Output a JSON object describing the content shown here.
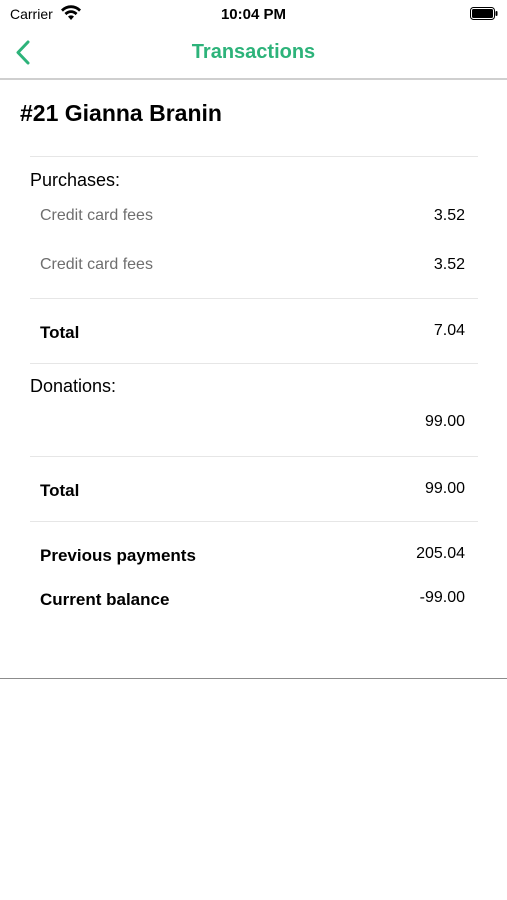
{
  "status_bar": {
    "carrier": "Carrier",
    "time": "10:04 PM"
  },
  "nav": {
    "title": "Transactions"
  },
  "customer": {
    "heading": "#21 Gianna Branin"
  },
  "purchases": {
    "label": "Purchases:",
    "items": [
      {
        "name": "Credit card fees",
        "amount": "3.52"
      },
      {
        "name": "Credit card fees",
        "amount": "3.52"
      }
    ],
    "total_label": "Total",
    "total_amount": "7.04"
  },
  "donations": {
    "label": "Donations:",
    "items": [
      {
        "name": "",
        "amount": "99.00"
      }
    ],
    "total_label": "Total",
    "total_amount": "99.00"
  },
  "summary": {
    "previous_payments_label": "Previous payments",
    "previous_payments_amount": "205.04",
    "current_balance_label": "Current balance",
    "current_balance_amount": "-99.00"
  },
  "colors": {
    "accent": "#2db37a"
  }
}
